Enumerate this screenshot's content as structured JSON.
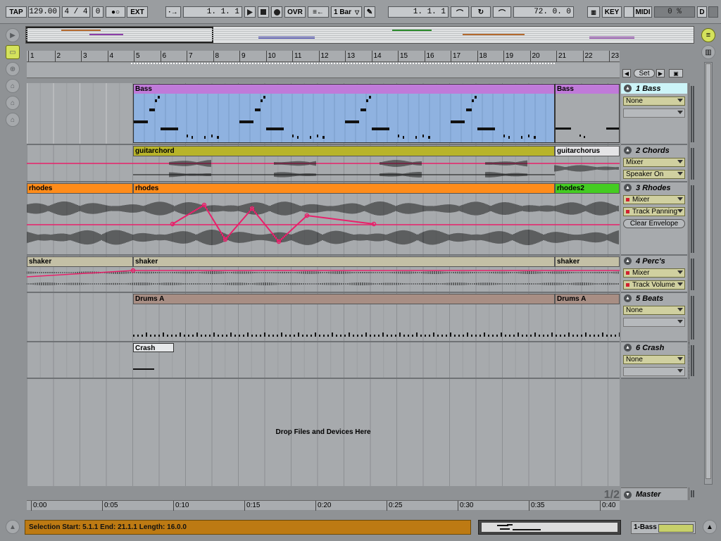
{
  "transport": {
    "tap": "TAP",
    "tempo": "129.00",
    "signature": "4 / 4",
    "quantize": "0",
    "ext": "EXT",
    "position": "1.  1.  1",
    "ovr": "OVR",
    "quant_menu": "1 Bar",
    "loop_start": "1.  1.  1",
    "loop_length": "72.  0.  0",
    "key": "KEY",
    "midi": "MIDI",
    "cpu": "0 %",
    "d": "D"
  },
  "ruler": {
    "bars": [
      "1",
      "2",
      "3",
      "4",
      "5",
      "6",
      "7",
      "8",
      "9",
      "10",
      "11",
      "12",
      "13",
      "14",
      "15",
      "16",
      "17",
      "18",
      "19",
      "20",
      "21",
      "22",
      "23"
    ]
  },
  "loop_controls": {
    "set": "Set"
  },
  "lanes": [
    {
      "clips": [
        {
          "name": "Bass",
          "color": "#c07ad9"
        },
        {
          "name": "Bass",
          "color": "#c07ad9"
        }
      ]
    },
    {
      "clips": [
        {
          "name": "guitarchord",
          "color": "#b8b42a"
        },
        {
          "name": "guitarchorus",
          "color": "#e4e4e6"
        }
      ]
    },
    {
      "clips": [
        {
          "name": "rhodes",
          "color": "#ff8c1a"
        },
        {
          "name": "rhodes",
          "color": "#ff8c1a"
        },
        {
          "name": "rhodes2",
          "color": "#44cc22"
        }
      ]
    },
    {
      "clips": [
        {
          "name": "shaker",
          "color": "#c4c0a6"
        },
        {
          "name": "shaker",
          "color": "#c4c0a6"
        },
        {
          "name": "shaker",
          "color": "#c4c0a6"
        }
      ]
    },
    {
      "clips": [
        {
          "name": "Drums A",
          "color": "#a88e84"
        },
        {
          "name": "Drums A",
          "color": "#a88e84"
        }
      ]
    },
    {
      "clips": [
        {
          "name": "Crash",
          "color": "#e6e8ea"
        }
      ]
    }
  ],
  "tracks": [
    {
      "number": "1",
      "name": "Bass",
      "chooser": "None",
      "control": ""
    },
    {
      "number": "2",
      "name": "Chords",
      "chooser": "Mixer",
      "control": "Speaker On"
    },
    {
      "number": "3",
      "name": "Rhodes",
      "chooser": "Mixer",
      "control": "Track Panning",
      "clear": "Clear Envelope"
    },
    {
      "number": "4",
      "name": "Perc's",
      "chooser": "Mixer",
      "control": "Track Volume"
    },
    {
      "number": "5",
      "name": "Beats",
      "chooser": "None",
      "control": ""
    },
    {
      "number": "6",
      "name": "Crash",
      "chooser": "None",
      "control": ""
    }
  ],
  "drop_hint": "Drop Files and Devices Here",
  "zoom_fraction": "1/2",
  "master": {
    "name": "Master"
  },
  "time_axis": [
    "0:00",
    "0:05",
    "0:10",
    "0:15",
    "0:20",
    "0:25",
    "0:30",
    "0:35",
    "0:40"
  ],
  "status": {
    "text": "Selection Start: 5.1.1   End: 21.1.1   Length: 16.0.0"
  },
  "current_track": "1-Bass",
  "colors": {
    "accent_highlight": "#ccf4f8",
    "automation": "#e8206a",
    "status_bar": "#bd7a13"
  }
}
